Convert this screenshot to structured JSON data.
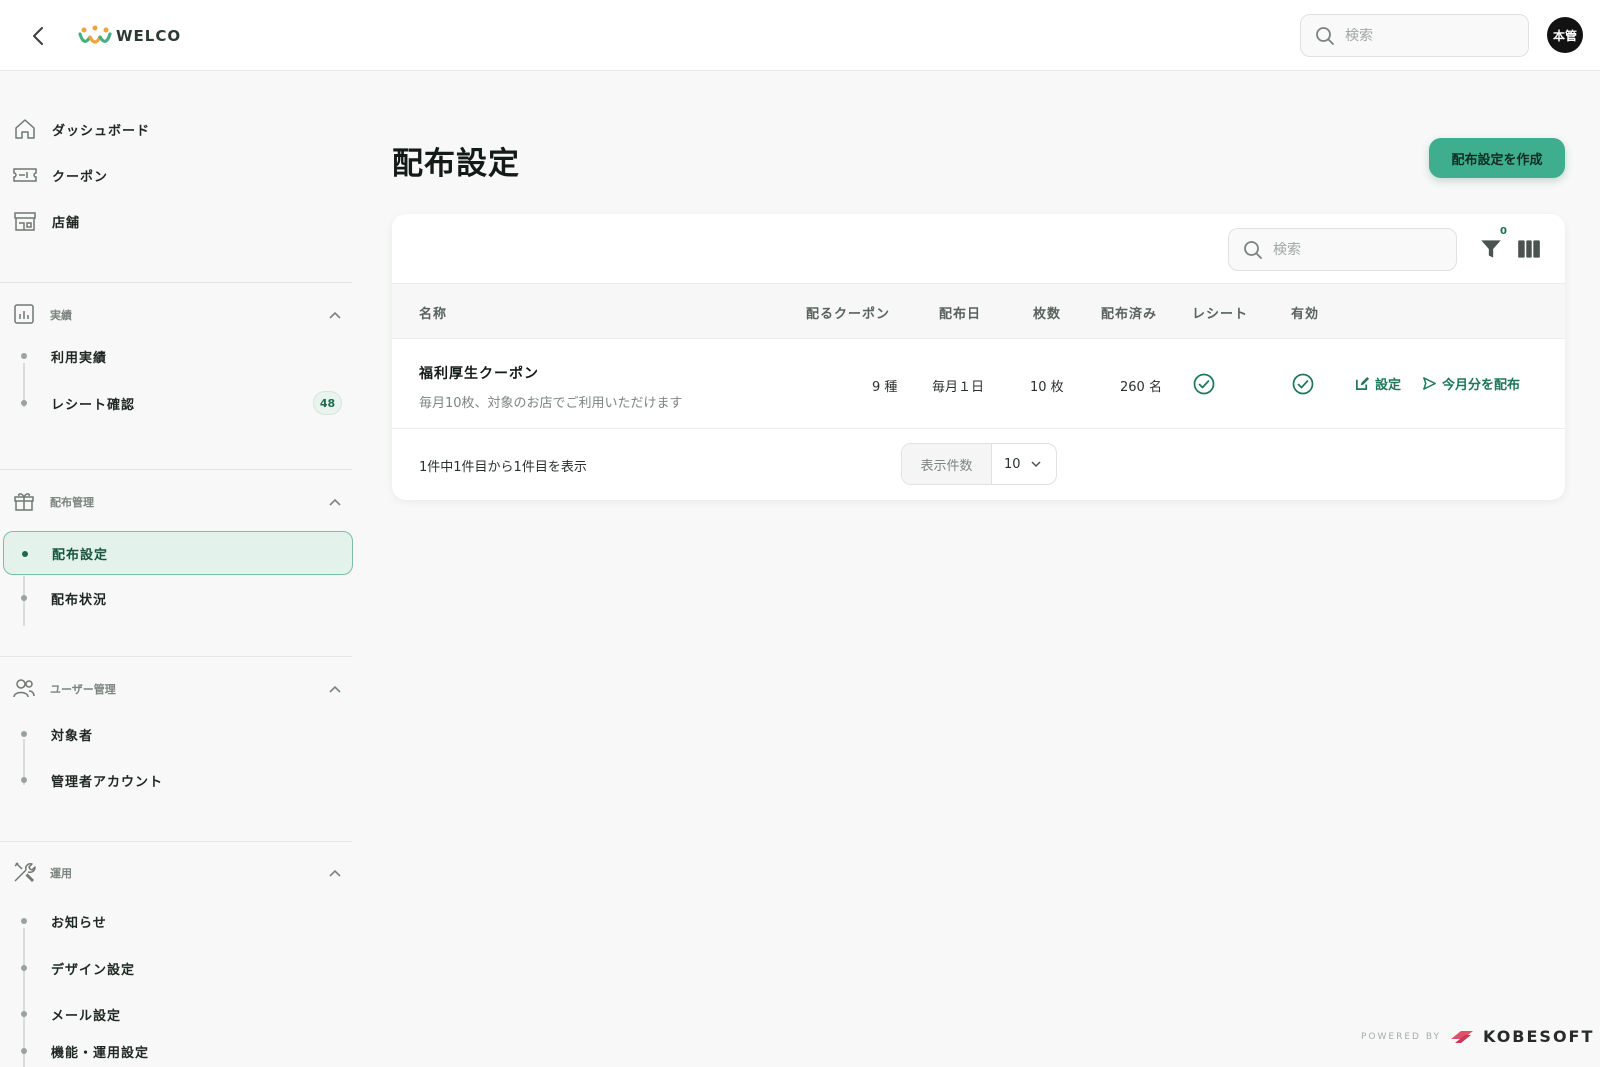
{
  "header": {
    "logo_text": "WELCO",
    "search_placeholder": "検索",
    "avatar_text": "本管"
  },
  "sidebar": {
    "top_items": [
      {
        "label": "ダッシュボード",
        "icon": "home-icon"
      },
      {
        "label": "クーポン",
        "icon": "ticket-icon"
      },
      {
        "label": "店舗",
        "icon": "store-icon"
      }
    ],
    "groups": [
      {
        "title": "実績",
        "icon": "chart-icon",
        "items": [
          {
            "label": "利用実績"
          },
          {
            "label": "レシート確認",
            "badge": "48"
          }
        ]
      },
      {
        "title": "配布管理",
        "icon": "gift-icon",
        "items": [
          {
            "label": "配布設定",
            "active": true
          },
          {
            "label": "配布状況"
          }
        ]
      },
      {
        "title": "ユーザー管理",
        "icon": "users-icon",
        "items": [
          {
            "label": "対象者"
          },
          {
            "label": "管理者アカウント"
          }
        ]
      },
      {
        "title": "運用",
        "icon": "tools-icon",
        "items": [
          {
            "label": "お知らせ"
          },
          {
            "label": "デザイン設定"
          },
          {
            "label": "メール設定"
          },
          {
            "label": "機能・運用設定"
          }
        ]
      }
    ]
  },
  "main": {
    "title": "配布設定",
    "create_button": "配布設定を作成",
    "table_search_placeholder": "検索",
    "filter_count": "0",
    "columns": [
      "名称",
      "配るクーポン",
      "配布日",
      "枚数",
      "配布済み",
      "レシート",
      "有効"
    ],
    "rows": [
      {
        "name": "福利厚生クーポン",
        "description": "毎月10枚、対象のお店でご利用いただけます",
        "coupons": "9 種",
        "date": "毎月１日",
        "count": "10 枚",
        "distributed": "260 名",
        "receipt": true,
        "enabled": true,
        "action_edit": "設定",
        "action_distribute": "今月分を配布"
      }
    ],
    "pagination_info": "1件中1件目から1件目を表示",
    "page_size_label": "表示件数",
    "page_size_value": "10"
  },
  "footer": {
    "powered_by": "POWERED BY",
    "brand": "KOBESOFT"
  },
  "colors": {
    "accent": "#3fae8e",
    "accent_dark": "#1e7757",
    "active_bg": "#e4f2ec"
  }
}
